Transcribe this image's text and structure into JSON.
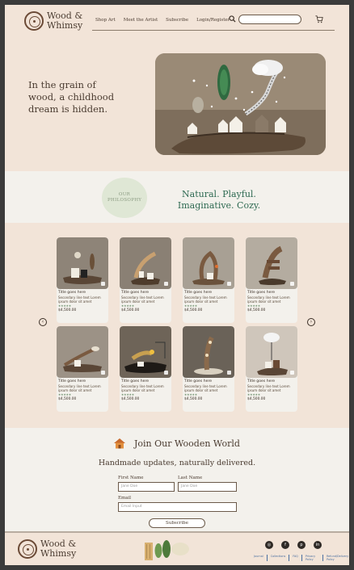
{
  "brand": {
    "line1": "Wood &",
    "line2": "Whimsy"
  },
  "nav": [
    "Shop Art",
    "Meet the Artist",
    "Subscribe",
    "Login/Register"
  ],
  "search": {
    "placeholder": ""
  },
  "hero": {
    "text": "In the grain of wood, a childhood dream is hidden."
  },
  "philosophy": {
    "badge": "OUR PHILOSOPHY",
    "text": "Natural. Playful. Imaginative. Cozy."
  },
  "products": [
    {
      "title": "Title goes here",
      "desc": "Secondary line text Lorem ipsum dolor sit amet",
      "rating": "★★★★★",
      "price": "$4,500.00",
      "scene": 0
    },
    {
      "title": "Title goes here",
      "desc": "Secondary line text Lorem ipsum dolor sit amet",
      "rating": "★★★★★",
      "price": "$4,500.00",
      "scene": 1
    },
    {
      "title": "Title goes here",
      "desc": "Secondary line text Lorem ipsum dolor sit amet",
      "rating": "★★★★★",
      "price": "$4,500.00",
      "scene": 2
    },
    {
      "title": "Title goes here",
      "desc": "Secondary line text Lorem ipsum dolor sit amet",
      "rating": "★★★★★",
      "price": "$4,500.00",
      "scene": 3
    },
    {
      "title": "Title goes here",
      "desc": "Secondary line text Lorem ipsum dolor sit amet",
      "rating": "★★★★★",
      "price": "$4,500.00",
      "scene": 4
    },
    {
      "title": "Title goes here",
      "desc": "Secondary line text Lorem ipsum dolor sit amet",
      "rating": "★★★★★",
      "price": "$4,500.00",
      "scene": 5
    },
    {
      "title": "Title goes here",
      "desc": "Secondary line text Lorem ipsum dolor sit amet",
      "rating": "★★★★★",
      "price": "$4,500.00",
      "scene": 6
    },
    {
      "title": "Title goes here",
      "desc": "Secondary line text Lorem ipsum dolor sit amet",
      "rating": "★★★★★",
      "price": "$4,500.00",
      "scene": 7
    }
  ],
  "newsletter": {
    "title": "Join Our Wooden World",
    "subtitle": "Handmade updates, naturally delivered.",
    "first_name_label": "First Name",
    "last_name_label": "Last Name",
    "email_label": "Email",
    "first_name_placeholder": "Jane Doe",
    "last_name_placeholder": "Jane Doe",
    "email_placeholder": "Email Input",
    "button": "Subscribe"
  },
  "footer": {
    "links": [
      "Journal",
      "Collections",
      "FAQ",
      "Privacy Policy",
      "Refund/Delivery Policy"
    ],
    "socials": [
      "instagram",
      "facebook",
      "pinterest",
      "linkedin"
    ]
  },
  "colors": {
    "background": "#f2e4d8",
    "accent_green": "#2f6a52",
    "panel": "#f3f1ec",
    "text_brown": "#4a3b30"
  }
}
